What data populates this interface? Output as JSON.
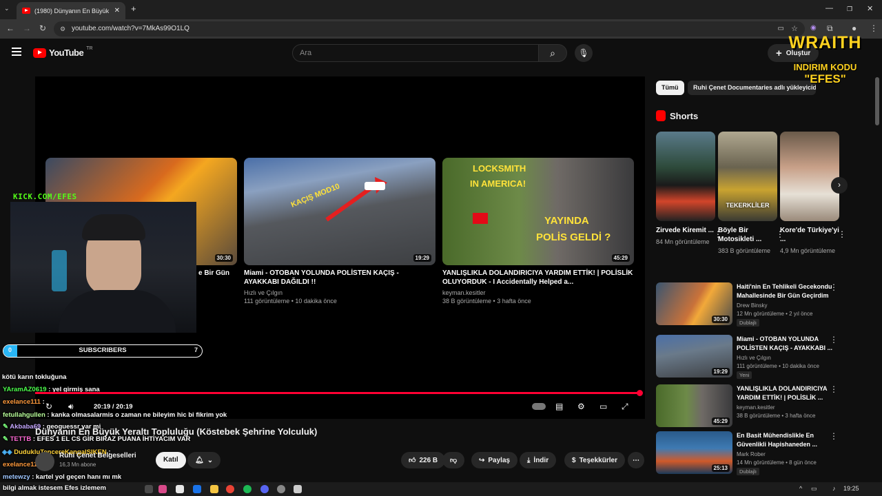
{
  "browser": {
    "tab_title": "(1980) Dünyanın En Büyük Yeralt",
    "url": "youtube.com/watch?v=7MkAs99O1LQ"
  },
  "header": {
    "logo_text": "YouTube",
    "logo_region": "TR",
    "search_placeholder": "Ara",
    "create_label": "Oluştur"
  },
  "overlay": {
    "brand": "WRAITH",
    "promo_line1": "INDIRIM KODU",
    "promo_code": "\"EFES\"",
    "kick_label": "KICK.COM/EFES",
    "subs_label": "SUBSCRIBERS",
    "subs_start": "0",
    "subs_goal": "7",
    "subs_progress": 0.07,
    "chat": [
      {
        "user": "",
        "text": "kötü karın tokluğuna"
      },
      {
        "user": "YAramAZ0619",
        "text": ": yel girmiş sana"
      },
      {
        "user": "exelance111",
        "text": ":"
      },
      {
        "user": "fetullahgullen",
        "text": ": kanka olmasalarmis o zaman ne bileyim hic bi fikrim yok"
      },
      {
        "user": "Akbaba69",
        "text": ": geoguessr var mi"
      },
      {
        "user": "TETTB",
        "text": ": EFES 1 EL CS GİR BIRAZ PUANA İHTİYACIM VAR"
      },
      {
        "user": "DudukluTencereKangalSIKEN",
        "text": ":"
      },
      {
        "user": "exelance111",
        "text": ":"
      },
      {
        "user": "metewzy",
        "text": ": kartel yol geçen hanı mı mk"
      },
      {
        "user": "",
        "text": "bilgi almak istesem Efes izlemem"
      }
    ]
  },
  "endcards": [
    {
      "title": "e Bir Gün",
      "channel": "",
      "meta": "",
      "duration": "30:30"
    },
    {
      "title": "Miami - OTOBAN YOLUNDA POLİSTEN KAÇIŞ - AYAKKABI DAĞILDI !!",
      "channel": "Hızlı ve Çılgın",
      "meta": "111 görüntüleme • 10 dakika önce",
      "duration": "19:29",
      "thumb_text": "KAÇIŞ MOD10"
    },
    {
      "title": "YANLIŞLIKLA DOLANDIRICIYA YARDIM ETTİK! | POLİSLİK OLUYORDUK - I Accidentally Helped a...",
      "channel": "keyman.kesitler",
      "meta": "38 B görüntüleme • 3 hafta önce",
      "duration": "45:29",
      "thumb_text_1": "LOCKSMITH",
      "thumb_text_2": "IN AMERICA!",
      "thumb_text_3": "YAYINDA",
      "thumb_text_4": "POLİS GELDİ ?"
    }
  ],
  "player": {
    "time": "20:19 / 20:19",
    "progress": 1.0
  },
  "video": {
    "title": "Dünyanın En Büyük Yeraltı Topluluğu (Köstebek Şehrine Yolculuk)",
    "channel": "Ruhi Çenet Belgeselleri",
    "subs": "16,3 Mn abone",
    "join": "Katıl",
    "likes": "226 B",
    "share": "Paylaş",
    "download": "İndir",
    "thanks": "Teşekkürler"
  },
  "sidebar": {
    "chips": [
      "Tümü",
      "Ruhi Çenet Documentaries adlı yükleyicid"
    ],
    "shorts_heading": "Shorts",
    "shorts": [
      {
        "title": "Zirvede Kiremit ...",
        "views": "84 Mn görüntüleme"
      },
      {
        "title": "Böyle Bir Motosikleti ...",
        "views": "383 B görüntüleme",
        "thumb_text": "TEKERKLİLER"
      },
      {
        "title": "Kore'de Türkiye'yi ...",
        "views": "4,9 Mn görüntüleme"
      }
    ],
    "recs": [
      {
        "title": "Haiti'nin En Tehlikeli Gecekondu Mahallesinde Bir Gün Geçirdim",
        "channel": "Drew Binsky",
        "meta": "12 Mn görüntüleme • 2 yıl önce",
        "badge": "Dublajlı",
        "duration": "30:30"
      },
      {
        "title": "Miami - OTOBAN YOLUNDA POLİSTEN KAÇIŞ - AYAKKABI ...",
        "channel": "Hızlı ve Çılgın",
        "meta": "111 görüntüleme • 10 dakika önce",
        "badge": "Yeni",
        "duration": "19:29"
      },
      {
        "title": "YANLIŞLIKLA DOLANDIRICIYA YARDIM ETTİK! | POLİSLİK ...",
        "channel": "keyman.kesitler",
        "meta": "38 B görüntüleme • 3 hafta önce",
        "badge": "",
        "duration": "45:29"
      },
      {
        "title": "En Basit Mühendislikle En Güvenlikli Hapishaneden ...",
        "channel": "Mark Rober",
        "meta": "14 Mn görüntüleme • 8 gün önce",
        "badge": "Dublajlı",
        "duration": "25:13"
      }
    ]
  },
  "taskbar": {
    "time": "19:25"
  }
}
